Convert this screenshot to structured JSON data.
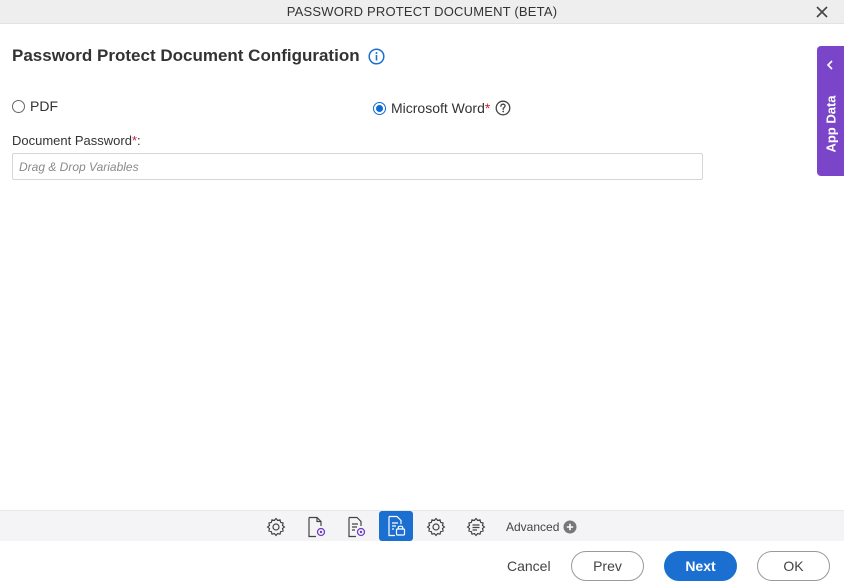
{
  "window": {
    "title": "PASSWORD PROTECT DOCUMENT (BETA)"
  },
  "main": {
    "heading": "Password Protect Document Configuration",
    "radios": [
      {
        "label": "PDF",
        "checked": false
      },
      {
        "label": "Microsoft Word",
        "checked": true,
        "required_mark": "*"
      }
    ],
    "password_field": {
      "label": "Document Password",
      "required_mark": "*",
      "suffix": ":",
      "placeholder": "Drag & Drop Variables",
      "value": ""
    }
  },
  "side_panel": {
    "label": "App Data"
  },
  "toolbar": {
    "icons": [
      "gear-icon",
      "document-settings-icon",
      "document-list-settings-icon",
      "document-lock-icon",
      "gear-icon",
      "list-settings-icon"
    ],
    "active_index": 3,
    "advanced_label": "Advanced"
  },
  "footer": {
    "cancel_label": "Cancel",
    "prev_label": "Prev",
    "next_label": "Next",
    "ok_label": "OK"
  },
  "colors": {
    "accent": "#1b6fd1",
    "side_panel": "#7b45c9",
    "required": "#c0243c"
  }
}
